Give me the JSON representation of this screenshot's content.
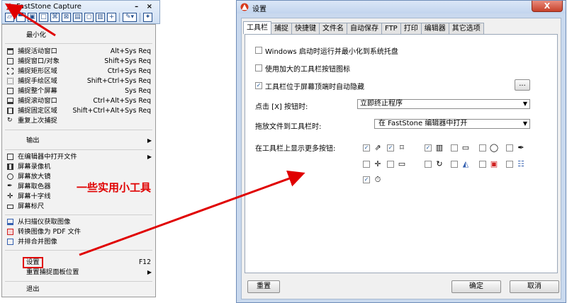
{
  "left": {
    "toolbar_title": "FastStone Capture",
    "title_controls": "– ×",
    "menu": {
      "minimize": "最小化",
      "capture_items": [
        {
          "label": "捕捉活动窗口",
          "accel": "Alt+Sys Req"
        },
        {
          "label": "捕捉窗口/对象",
          "accel": "Shift+Sys Req"
        },
        {
          "label": "捕捉矩形区域",
          "accel": "Ctrl+Sys Req"
        },
        {
          "label": "捕捉手绘区域",
          "accel": "Shift+Ctrl+Sys Req"
        },
        {
          "label": "捕捉整个屏幕",
          "accel": "Sys Req"
        },
        {
          "label": "捕捉滚动窗口",
          "accel": "Ctrl+Alt+Sys Req"
        },
        {
          "label": "捕捉固定区域",
          "accel": "Shift+Ctrl+Alt+Sys Req"
        },
        {
          "label": "重复上次捕捉",
          "accel": ""
        }
      ],
      "output": "输出",
      "tools": [
        {
          "label": "在编辑器中打开文件",
          "submenu": true
        },
        {
          "label": "屏幕录像机"
        },
        {
          "label": "屏幕放大镜"
        },
        {
          "label": "屏幕取色器"
        },
        {
          "label": "屏幕十字线"
        },
        {
          "label": "屏幕标尺"
        }
      ],
      "scan": [
        {
          "label": "从扫描仪获取图像"
        },
        {
          "label": "转换图像为 PDF 文件"
        },
        {
          "label": "并排合并图像"
        }
      ],
      "settings": "设置",
      "settings_accel": "F12",
      "reset_pos": "重置捕捉面板位置",
      "exit": "退出"
    },
    "callout": "一些实用小工具"
  },
  "dialog": {
    "title": "设置",
    "close": "X",
    "tabs": [
      "工具栏",
      "捕捉",
      "快捷键",
      "文件名",
      "自动保存",
      "FTP",
      "打印",
      "编辑器",
      "其它选项"
    ],
    "active_tab": "工具栏",
    "options": [
      {
        "label": "Windows 启动时运行并最小化到系统托盘",
        "checked": false
      },
      {
        "label": "使用加大的工具栏按钮图标",
        "checked": false
      },
      {
        "label": "工具栏位于屏幕顶端时自动隐藏",
        "checked": true
      }
    ],
    "browse_btn": "...",
    "close_action_label": "点击 [X] 按钮时:",
    "close_action_value": "立即终止程序",
    "drag_label": "拖放文件到工具栏时:",
    "drag_value": "在 FastStone 编辑器中打开",
    "more_buttons_label": "在工具栏上显示更多按钮:",
    "reset_btn": "重置",
    "ok_btn": "确定",
    "cancel_btn": "取消"
  },
  "colors": {
    "accent_red": "#e00000",
    "icon_blue": "#24508f"
  }
}
